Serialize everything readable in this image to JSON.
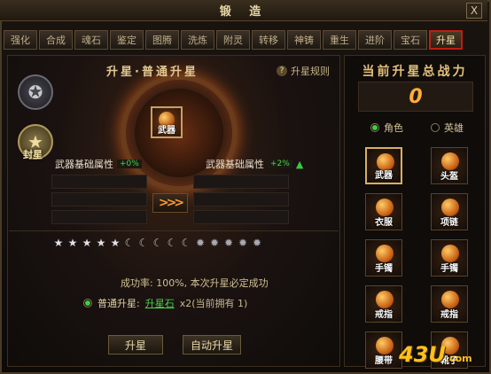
{
  "window": {
    "title": "锻 造",
    "close_label": "X"
  },
  "tabs": [
    {
      "label": "强化",
      "active": false
    },
    {
      "label": "合成",
      "active": false
    },
    {
      "label": "魂石",
      "active": false
    },
    {
      "label": "鉴定",
      "active": false
    },
    {
      "label": "图腾",
      "active": false
    },
    {
      "label": "洗炼",
      "active": false
    },
    {
      "label": "附灵",
      "active": false
    },
    {
      "label": "转移",
      "active": false
    },
    {
      "label": "神铸",
      "active": false
    },
    {
      "label": "重生",
      "active": false
    },
    {
      "label": "进阶",
      "active": false
    },
    {
      "label": "宝石",
      "active": false
    },
    {
      "label": "升星",
      "active": true
    }
  ],
  "forge": {
    "title": "升星·普通升星",
    "rules_label": "升星规则",
    "rules_icon": "?",
    "seal_label": "封星",
    "item_label": "武器",
    "attr_left_label": "武器基础属性",
    "attr_left_value": "+0%",
    "attr_right_label": "武器基础属性",
    "attr_right_value": "+2%",
    "arrow_glyph": ">>>",
    "up_icon": "▲",
    "stars": [
      "star",
      "star",
      "star",
      "star",
      "star",
      "moon",
      "moon",
      "moon",
      "moon",
      "moon",
      "sun",
      "sun",
      "sun",
      "sun",
      "sun"
    ],
    "success_text": "成功率: 100%, 本次升星必定成功",
    "upgrade_mode": "普通升星:",
    "stone_name": "升星石",
    "stone_count": "x2(当前拥有 1)",
    "btn_upgrade": "升星",
    "btn_auto": "自动升星"
  },
  "power": {
    "title": "当前升星总战力",
    "value": "0",
    "role_label": "角色",
    "hero_label": "英雄"
  },
  "equipment": [
    {
      "label": "武器",
      "selected": true
    },
    {
      "label": "头盔",
      "selected": false
    },
    {
      "label": "衣服",
      "selected": false
    },
    {
      "label": "项链",
      "selected": false
    },
    {
      "label": "手镯",
      "selected": false
    },
    {
      "label": "手镯",
      "selected": false
    },
    {
      "label": "戒指",
      "selected": false
    },
    {
      "label": "戒指",
      "selected": false
    },
    {
      "label": "腰带",
      "selected": false
    },
    {
      "label": "靴子",
      "selected": false
    }
  ],
  "watermark": {
    "number": "43U",
    "domain": ".com"
  },
  "colors": {
    "accent": "#c21c12",
    "gold": "#ffae3a",
    "green": "#4cd24c"
  }
}
